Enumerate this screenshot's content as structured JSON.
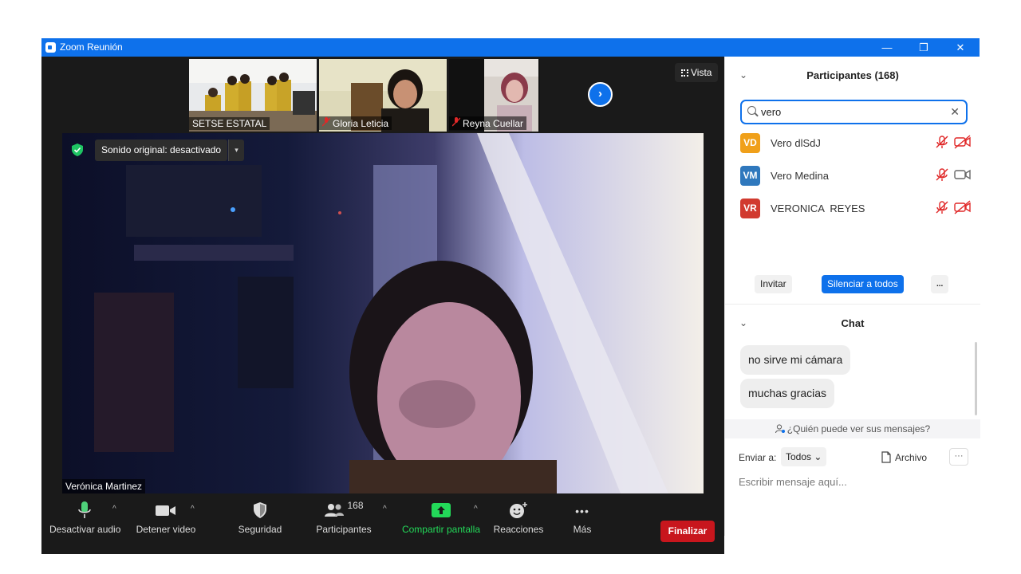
{
  "window": {
    "title": "Zoom Reunión",
    "icon": "zoom-logo-icon",
    "controls": {
      "minimize": "—",
      "restore": "❐",
      "close": "✕"
    }
  },
  "thumbnails": [
    {
      "name": "SETSE ESTATAL",
      "muted": false
    },
    {
      "name": "Gloria Leticia",
      "muted": true
    },
    {
      "name": "Reyna Cuellar",
      "muted": true
    }
  ],
  "view_button": {
    "label": "Vista",
    "icon": "grid-icon"
  },
  "next_page_icon": "chevron-right-icon",
  "original_sound": {
    "label": "Sonido original: desactivado",
    "caret": "▾"
  },
  "active_speaker": "Verónica Martinez",
  "toolbar": {
    "audio": "Desactivar audio",
    "video": "Detener video",
    "security": "Seguridad",
    "participants": "Participantes",
    "participant_count": "168",
    "share": "Compartir pantalla",
    "reactions": "Reacciones",
    "more": "Más",
    "end": "Finalizar",
    "caret": "^",
    "more_dots": "•••"
  },
  "participants_panel": {
    "title": "Participantes (168)",
    "collapse": "⌄",
    "search_value": "vero",
    "clear": "✕",
    "participants": [
      {
        "initials": "VD",
        "name": "Vero dlSdJ",
        "color": "#f0a01a",
        "mic_muted": true,
        "video_off": true
      },
      {
        "initials": "VM",
        "name": "Vero Medina",
        "color": "#2f78bd",
        "mic_muted": true,
        "video_off": false
      },
      {
        "initials": "VR",
        "name": "VERONICA  REYES",
        "color": "#d13a2f",
        "mic_muted": true,
        "video_off": true
      }
    ],
    "buttons": {
      "invite": "Invitar",
      "mute_all": "Silenciar a todos",
      "more": "..."
    }
  },
  "chat": {
    "title": "Chat",
    "collapse": "⌄",
    "messages": [
      "no sirve mi cámara",
      "muchas gracias"
    ],
    "who_can_see": "¿Quién puede ver sus mensajes?",
    "send_to_label": "Enviar a:",
    "send_to_value": "Todos",
    "send_to_caret": "⌄",
    "file_label": "Archivo",
    "more": "···",
    "input_placeholder": "Escribir mensaje aquí..."
  },
  "colors": {
    "accent": "#0e71eb",
    "end_red": "#c8161d",
    "share_green": "#23d959",
    "mute_red": "#e02828"
  }
}
